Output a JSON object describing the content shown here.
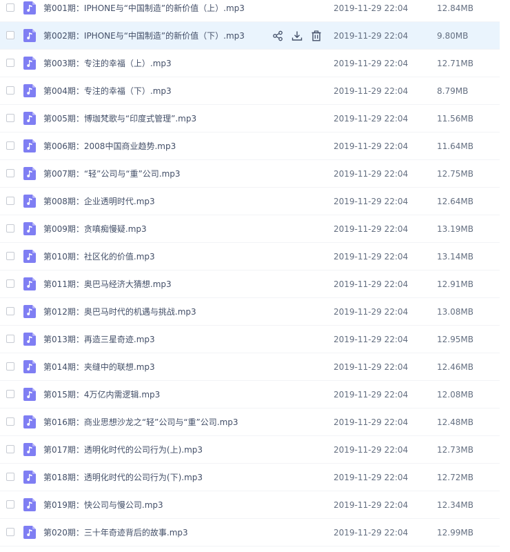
{
  "colors": {
    "icon_bg": "#7f7ef3",
    "hover_row_bg": "#eaf4fd",
    "text": "#424e67",
    "meta_text": "#636e80"
  },
  "row_actions": {
    "share_icon": "share-icon",
    "download_icon": "download-icon",
    "delete_icon": "trash-icon"
  },
  "files": [
    {
      "name": "第001期：IPHONE与“中国制造”的新价值（上）.mp3",
      "date": "2019-11-29 22:04",
      "size": "12.84MB"
    },
    {
      "name": "第002期：IPHONE与“中国制造”的新价值（下）.mp3",
      "date": "2019-11-29 22:04",
      "size": "9.80MB"
    },
    {
      "name": "第003期：专注的幸福（上）.mp3",
      "date": "2019-11-29 22:04",
      "size": "12.71MB"
    },
    {
      "name": "第004期：专注的幸福（下）.mp3",
      "date": "2019-11-29 22:04",
      "size": "8.79MB"
    },
    {
      "name": "第005期：博珈梵歌与“印度式管理”.mp3",
      "date": "2019-11-29 22:04",
      "size": "11.56MB"
    },
    {
      "name": "第006期：2008中国商业趋势.mp3",
      "date": "2019-11-29 22:04",
      "size": "11.64MB"
    },
    {
      "name": "第007期：“轻”公司与“重”公司.mp3",
      "date": "2019-11-29 22:04",
      "size": "12.75MB"
    },
    {
      "name": "第008期：企业透明时代.mp3",
      "date": "2019-11-29 22:04",
      "size": "12.64MB"
    },
    {
      "name": "第009期：贪嗔痴慢疑.mp3",
      "date": "2019-11-29 22:04",
      "size": "13.19MB"
    },
    {
      "name": "第010期：社区化的价值.mp3",
      "date": "2019-11-29 22:04",
      "size": "13.14MB"
    },
    {
      "name": "第011期：奥巴马经济大猜想.mp3",
      "date": "2019-11-29 22:04",
      "size": "12.91MB"
    },
    {
      "name": "第012期：奥巴马时代的机遇与挑战.mp3",
      "date": "2019-11-29 22:04",
      "size": "13.08MB"
    },
    {
      "name": "第013期：再造三星奇迹.mp3",
      "date": "2019-11-29 22:04",
      "size": "12.95MB"
    },
    {
      "name": "第014期：夹缝中的联想.mp3",
      "date": "2019-11-29 22:04",
      "size": "12.46MB"
    },
    {
      "name": "第015期：4万亿内需逻辑.mp3",
      "date": "2019-11-29 22:04",
      "size": "12.08MB"
    },
    {
      "name": "第016期：商业思想沙龙之“轻”公司与“重”公司.mp3",
      "date": "2019-11-29 22:04",
      "size": "12.48MB"
    },
    {
      "name": "第017期：透明化时代的公司行为(上).mp3",
      "date": "2019-11-29 22:04",
      "size": "12.73MB"
    },
    {
      "name": "第018期：透明化时代的公司行为(下).mp3",
      "date": "2019-11-29 22:04",
      "size": "12.72MB"
    },
    {
      "name": "第019期：快公司与慢公司.mp3",
      "date": "2019-11-29 22:04",
      "size": "12.34MB"
    },
    {
      "name": "第020期：三十年奇迹背后的故事.mp3",
      "date": "2019-11-29 22:04",
      "size": "12.99MB"
    }
  ]
}
